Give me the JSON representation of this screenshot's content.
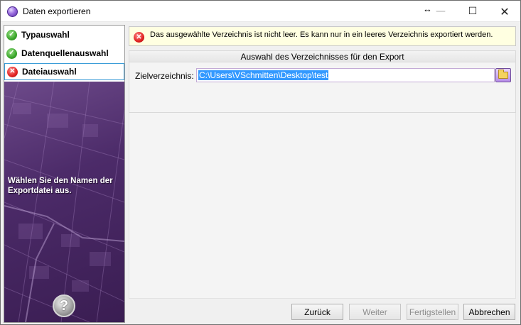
{
  "window": {
    "title": "Daten exportieren",
    "resize_glyph": "↔",
    "minimize_glyph": "—",
    "maximize_glyph": "☐",
    "close_glyph": "✕"
  },
  "steps": [
    {
      "label": "Typauswahl",
      "status": "done",
      "icon": "check-icon"
    },
    {
      "label": "Datenquellenauswahl",
      "status": "done",
      "icon": "check-icon"
    },
    {
      "label": "Dateiauswahl",
      "status": "error",
      "icon": "error-icon"
    }
  ],
  "left_panel": {
    "hint": "Wählen Sie den Namen der Exportdatei aus.",
    "help_glyph": "?"
  },
  "error_banner": {
    "text": "Das ausgewählte Verzeichnis ist nicht leer. Es kann nur in ein leeres Verzeichnis exportiert werden.",
    "icon": "error-icon"
  },
  "directory_group": {
    "header": "Auswahl des Verzeichnisses für den Export",
    "field_label": "Zielverzeichnis:",
    "value": "C:\\Users\\VSchmitten\\Desktop\\test"
  },
  "buttons": {
    "back": "Zurück",
    "next": "Weiter",
    "finish": "Fertigstellen",
    "cancel": "Abbrechen"
  },
  "colors": {
    "accent_purple": "#5a2ea6",
    "success_green": "#3aa52a",
    "error_red": "#e02020",
    "banner_background": "#ffffe1",
    "selection_blue": "#3399ff"
  }
}
